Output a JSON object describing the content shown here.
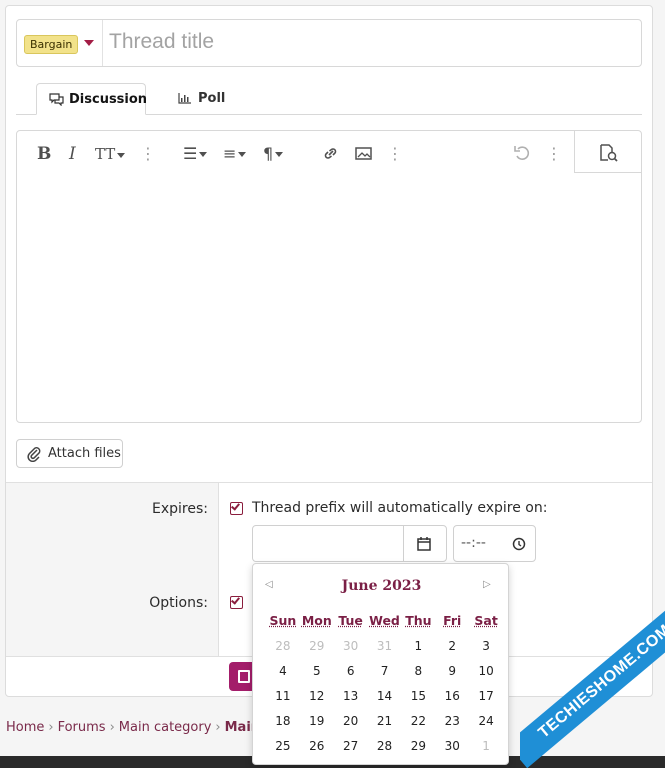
{
  "title_row": {
    "prefix_badge": "Bargain",
    "title_placeholder": "Thread title"
  },
  "tabs": [
    {
      "label": "Discussion",
      "icon": "comments-icon",
      "active": true
    },
    {
      "label": "Poll",
      "icon": "bar-chart-icon",
      "active": false
    }
  ],
  "editor": {
    "toolbar": [
      "bold",
      "italic",
      "text-size",
      "more",
      "list",
      "align",
      "paragraph",
      "link",
      "image",
      "more",
      "undo",
      "more",
      "preview"
    ]
  },
  "attach": {
    "label": "Attach files"
  },
  "form": {
    "expires_label": "Expires:",
    "expires_checkbox_text": "Thread prefix will automatically expire on:",
    "expires_checked": true,
    "date_value": "",
    "time_placeholder": "--:--",
    "options_label": "Options:",
    "options_checked": true
  },
  "calendar": {
    "month": "June",
    "year": "2023",
    "weekdays": [
      "Sun",
      "Mon",
      "Tue",
      "Wed",
      "Thu",
      "Fri",
      "Sat"
    ],
    "weeks": [
      [
        {
          "d": "28",
          "m": true
        },
        {
          "d": "29",
          "m": true
        },
        {
          "d": "30",
          "m": true
        },
        {
          "d": "31",
          "m": true
        },
        {
          "d": "1"
        },
        {
          "d": "2"
        },
        {
          "d": "3"
        }
      ],
      [
        {
          "d": "4"
        },
        {
          "d": "5"
        },
        {
          "d": "6"
        },
        {
          "d": "7"
        },
        {
          "d": "8"
        },
        {
          "d": "9"
        },
        {
          "d": "10"
        }
      ],
      [
        {
          "d": "11"
        },
        {
          "d": "12"
        },
        {
          "d": "13"
        },
        {
          "d": "14"
        },
        {
          "d": "15"
        },
        {
          "d": "16"
        },
        {
          "d": "17"
        }
      ],
      [
        {
          "d": "18"
        },
        {
          "d": "19"
        },
        {
          "d": "20"
        },
        {
          "d": "21"
        },
        {
          "d": "22"
        },
        {
          "d": "23"
        },
        {
          "d": "24"
        }
      ],
      [
        {
          "d": "25"
        },
        {
          "d": "26"
        },
        {
          "d": "27"
        },
        {
          "d": "28"
        },
        {
          "d": "29"
        },
        {
          "d": "30"
        },
        {
          "d": "1",
          "m": true
        }
      ]
    ]
  },
  "breadcrumb": {
    "items": [
      "Home",
      "Forums",
      "Main category",
      "Main"
    ]
  },
  "watermark": {
    "text": "TECHIESHOME.COM"
  },
  "colors": {
    "accent": "#a31d45",
    "calendar_header": "#7a1f45",
    "badge_bg": "#f2e28a",
    "submit": "#a31d6a",
    "watermark": "#1f8fd6"
  }
}
